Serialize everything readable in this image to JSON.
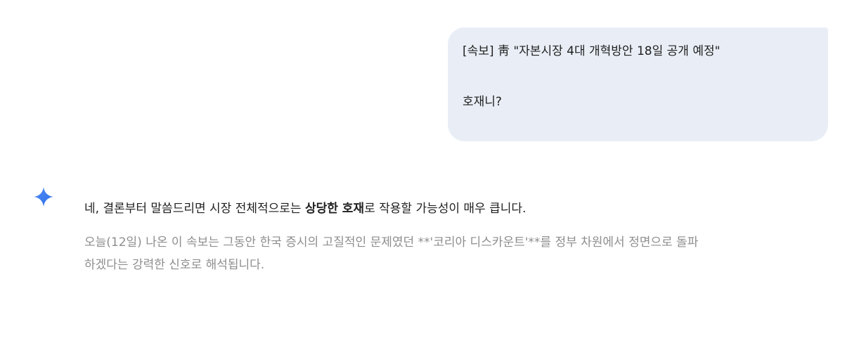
{
  "user_message": {
    "line1": "[속보] 靑 \"자본시장 4대 개혁방안 18일 공개 예정\"",
    "line2": "호재니?"
  },
  "response": {
    "lead_prefix": "네, 결론부터 말씀드리면 시장 전체적으로는 ",
    "lead_bold": "상당한 호재",
    "lead_suffix": "로 작용할 가능성이 매우 큽니다.",
    "paragraph": "오늘(12일) 나온 이 속보는 그동안 한국 증시의 고질적인 문제였던 **'코리아 디스카운트'**를 정부 차원에서 정면으로 돌파하겠다는 강력한 신호로 해석됩니다."
  },
  "colors": {
    "bubble_bg": "#e9eef6",
    "icon_blue": "#4285f4",
    "faded_text": "#8e8e8e"
  },
  "icons": {
    "assistant": "gemini-sparkle-icon"
  }
}
